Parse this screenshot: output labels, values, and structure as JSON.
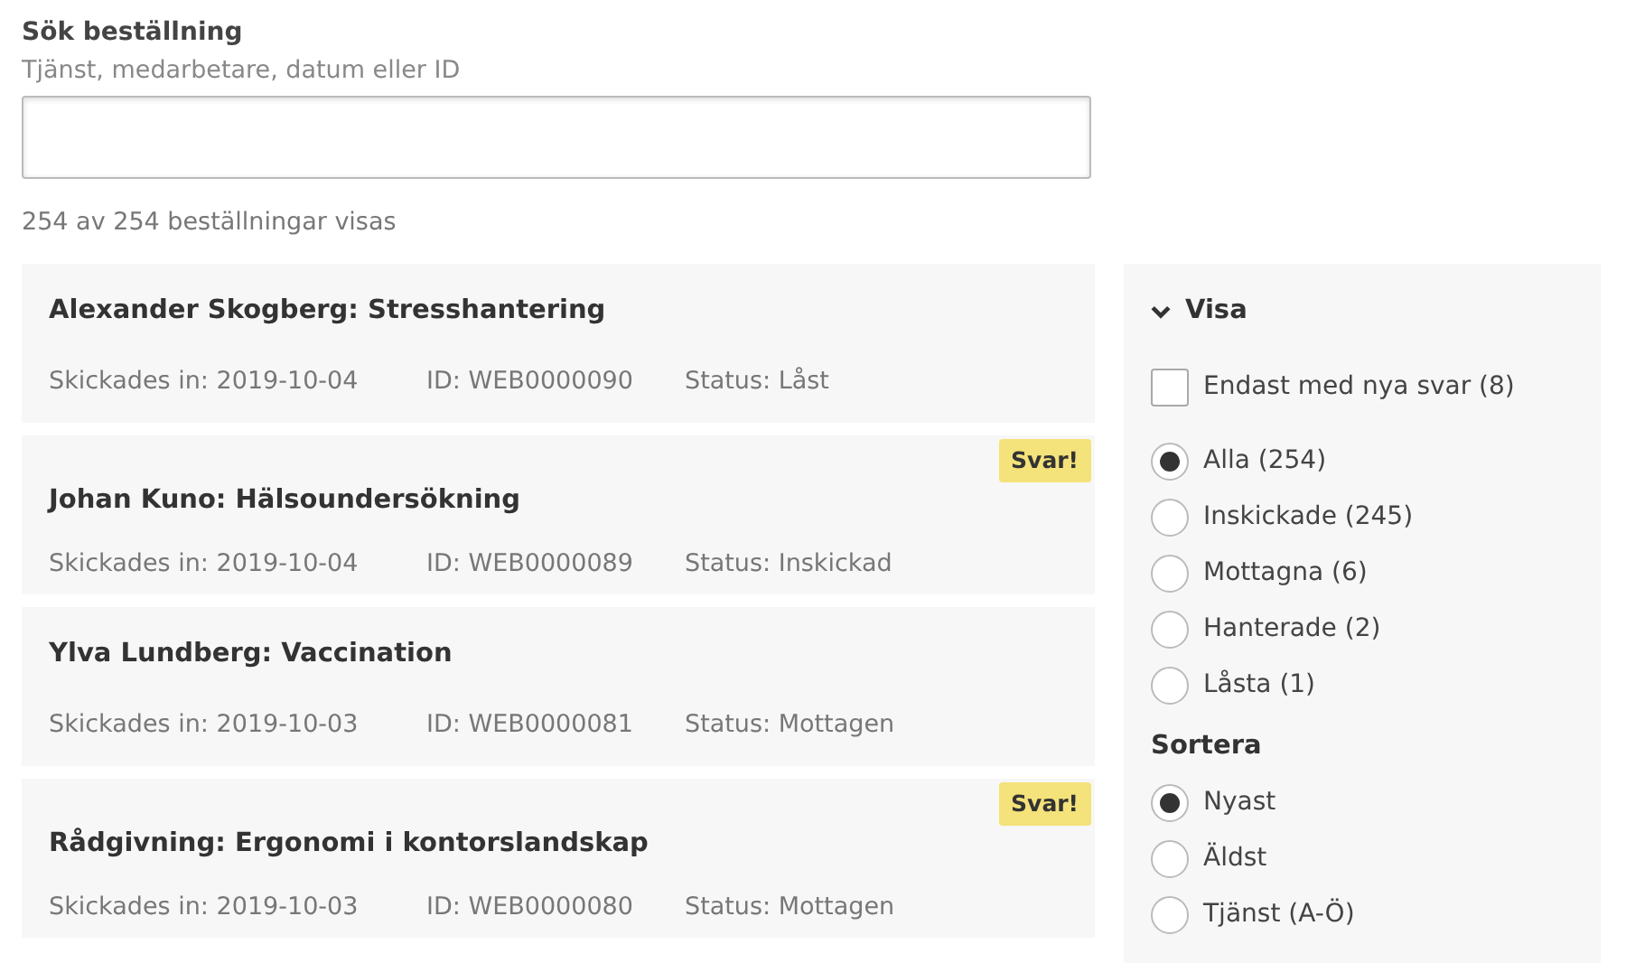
{
  "search": {
    "label": "Sök beställning",
    "hint": "Tjänst, medarbetare, datum eller ID"
  },
  "result_count": "254 av 254 beställningar visas",
  "orders": [
    {
      "title": "Alexander Skogberg: Stresshantering",
      "submitted": "Skickades in: 2019-10-04",
      "id": "ID: WEB0000090",
      "status": "Status: Låst"
    },
    {
      "title": "Johan Kuno: Hälsoundersökning",
      "submitted": "Skickades in: 2019-10-04",
      "id": "ID: WEB0000089",
      "status": "Status: Inskickad",
      "badge": "Svar!"
    },
    {
      "title": "Ylva Lundberg: Vaccination",
      "submitted": "Skickades in: 2019-10-03",
      "id": "ID: WEB0000081",
      "status": "Status: Mottagen"
    },
    {
      "title": "Rådgivning: Ergonomi i kontorslandskap",
      "submitted": "Skickades in: 2019-10-03",
      "id": "ID: WEB0000080",
      "status": "Status: Mottagen",
      "badge": "Svar!"
    }
  ],
  "filter_panel": {
    "title": "Visa",
    "expanded": true,
    "filters": [
      {
        "kind": "checkbox",
        "label": "Endast med nya svar (8)",
        "checked": false
      },
      {
        "kind": "radio",
        "label": "Alla (254)",
        "selected": true
      },
      {
        "kind": "radio",
        "label": "Inskickade (245)",
        "selected": false
      },
      {
        "kind": "radio",
        "label": "Mottagna (6)",
        "selected": false
      },
      {
        "kind": "radio",
        "label": "Hanterade (2)",
        "selected": false
      },
      {
        "kind": "radio",
        "label": "Låsta (1)",
        "selected": false
      }
    ],
    "sort": {
      "title": "Sortera",
      "options": [
        {
          "label": "Nyast",
          "selected": true
        },
        {
          "label": "Äldst",
          "selected": false
        },
        {
          "label": "Tjänst (A-Ö)",
          "selected": false
        }
      ]
    }
  }
}
